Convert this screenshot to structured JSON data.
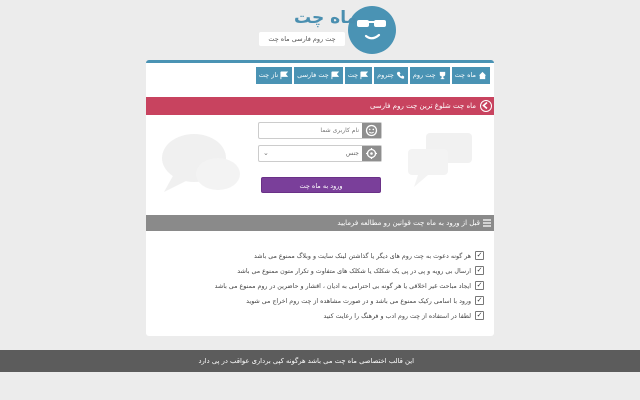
{
  "header": {
    "site_title": "ماه چت",
    "site_subtitle": "چت روم فارسی ماه چت"
  },
  "nav": {
    "items": [
      {
        "label": "ماه چت",
        "icon": "home-icon"
      },
      {
        "label": "چت روم",
        "icon": "trophy-icon"
      },
      {
        "label": "چتروم",
        "icon": "phone-icon"
      },
      {
        "label": "چت",
        "icon": "flag-icon"
      },
      {
        "label": "چت فارسی",
        "icon": "flag-icon"
      },
      {
        "label": "ناز چت",
        "icon": "flag-icon"
      }
    ]
  },
  "login": {
    "bar_title": "ماه چت شلوغ ترین چت روم فارسی",
    "username_placeholder": "نام کاربری شما",
    "gender_selected": "جنس",
    "enter_button": "ورود به ماه چت"
  },
  "rules": {
    "bar_title": "قبل از ورود به ماه چت قوانین رو مطالعه فرمایید",
    "items": [
      "هر گونه دعوت به چت روم های دیگر یا گذاشتن لینک سایت و وبلاگ ممنوع می باشد",
      "ارسال بی رویه و پی در پی یک شکلک یا شکلک های متفاوت و تکرار متون ممنوع می باشد",
      "ایجاد مباحث غیر اخلاقی یا هر گونه بی احترامی به ادیان ، اقشار و حاضرین در روم ممنوع می باشد",
      "ورود با اسامی رکیک ممنوع می باشد و در صورت مشاهده از چت روم اخراج می شوید",
      "لطفا در استفاده از چت روم ادب و فرهنگ را رعایت کنید"
    ]
  },
  "footer": {
    "text": "این قالب اختصاصی ماه چت می باشد هرگونه کپی برداری عواقب در پی دارد"
  },
  "colors": {
    "brand_blue": "#4a93b4",
    "login_bar": "#c8435f",
    "enter_button": "#7a3f9a",
    "rules_bar": "#8a8a8a",
    "footer": "#5c5c5c"
  }
}
